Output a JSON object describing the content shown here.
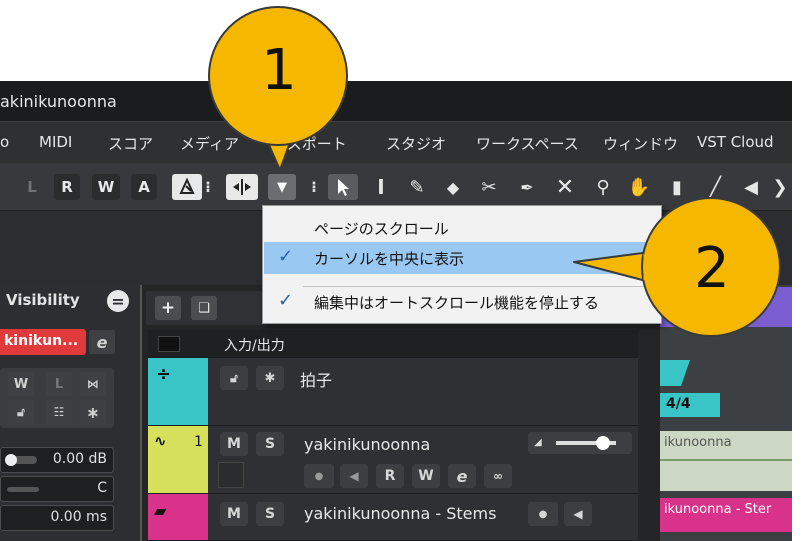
{
  "window": {
    "title": "akinikunoonna"
  },
  "menu": [
    "o",
    "MIDI",
    "スコア",
    "メディア",
    "ンスポート",
    "スタジオ",
    "ワークスペース",
    "ウィンドウ",
    "VST Cloud"
  ],
  "toolbar": {
    "automation": [
      "L",
      "R",
      "W",
      "A"
    ],
    "dropdown_arrow": "▼"
  },
  "dropdown": {
    "items": [
      {
        "label": "ページのスクロール",
        "checked": false,
        "highlighted": false
      },
      {
        "label": "カーソルを中央に表示",
        "checked": true,
        "highlighted": true
      },
      {
        "label": "編集中はオートスクロール機能を停止する",
        "checked": true,
        "highlighted": false
      }
    ],
    "check_glyph": "✓"
  },
  "callouts": {
    "one": "1",
    "two": "2"
  },
  "inspector": {
    "visibility_label": "Visibility",
    "track_name": "kinikun...",
    "mini_buttons": [
      "W",
      "L"
    ],
    "volume": "0.00 dB",
    "pan": "C",
    "delay": "0.00 ms"
  },
  "tracklist": {
    "folder_label": "入力/出力",
    "tracks": [
      {
        "name": "拍子",
        "number": ""
      },
      {
        "name": "yakinikunoonna",
        "number": "1",
        "m": "M",
        "s": "S",
        "r": "R",
        "w": "W"
      },
      {
        "name": "yakinikunoonna - Stems",
        "m": "M",
        "s": "S"
      }
    ]
  },
  "arrange": {
    "signature": "4/4",
    "clip_audio": "ikunoonna",
    "clip_stems": "ikunoonna - Ster"
  },
  "colors": {
    "highlight": "#99c9f2",
    "callout": "#f5b700",
    "track_cyan": "#39c5c5",
    "track_yellow": "#d6e05a",
    "track_magenta": "#d8328a",
    "record_red": "#e03a3a"
  }
}
